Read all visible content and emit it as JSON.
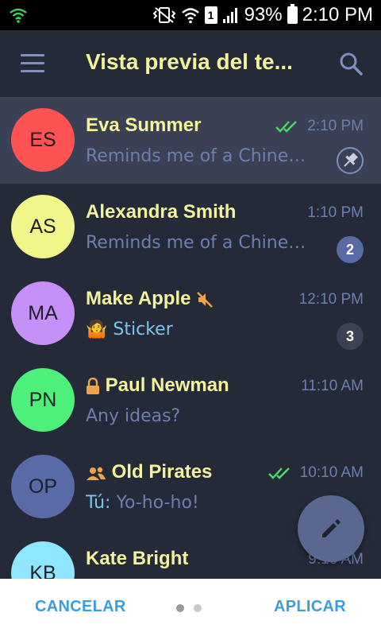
{
  "status_bar": {
    "battery_percent": "93%",
    "time": "2:10 PM",
    "sim_label": "1"
  },
  "app_bar": {
    "title": "Vista previa del te..."
  },
  "chats": [
    {
      "initials": "ES",
      "name": "Eva Summer",
      "time": "2:10 PM",
      "preview": "Reminds me of a Chines...",
      "avatar_color": "#ff5252",
      "read_check": true,
      "pinned": true
    },
    {
      "initials": "AS",
      "name": "Alexandra Smith",
      "time": "1:10 PM",
      "preview": "Reminds me of a Chines...",
      "avatar_color": "#f1f58a",
      "unread": "2",
      "badge_color": "#5a6aa6"
    },
    {
      "initials": "MA",
      "name": "Make Apple",
      "time": "12:10 PM",
      "preview": "Sticker",
      "preview_emoji": "🤷",
      "avatar_color": "#c591f9",
      "muted": true,
      "unread": "3",
      "badge_color": "#3c4254"
    },
    {
      "initials": "PN",
      "name": "Paul Newman",
      "time": "11:10 AM",
      "preview": "Any ideas?",
      "avatar_color": "#4cf07a",
      "secret": true
    },
    {
      "initials": "OP",
      "name": "Old Pirates",
      "time": "10:10 AM",
      "preview_sender": "Tú:",
      "preview": "Yo-ho-ho!",
      "avatar_color": "#5a6aa6",
      "group": true,
      "read_check": true
    },
    {
      "initials": "KB",
      "name": "Kate Bright",
      "time": "9:10 AM",
      "avatar_color": "#8ee6ff"
    }
  ],
  "bottom_bar": {
    "cancel_label": "CANCELAR",
    "apply_label": "APLICAR"
  },
  "colors": {
    "background": "#242a38",
    "name_text": "#f4f39b",
    "secondary_text": "#6c7fae",
    "accent_text": "#7cc6ec",
    "check_green": "#4cd964",
    "button_blue": "#3b9de0"
  },
  "icons": {
    "menu": "menu-icon",
    "search": "search-icon",
    "pin": "pin-icon",
    "mute": "mute-icon",
    "lock": "lock-icon",
    "group": "group-icon",
    "double_check": "double-check-icon",
    "compose": "pencil-icon"
  }
}
